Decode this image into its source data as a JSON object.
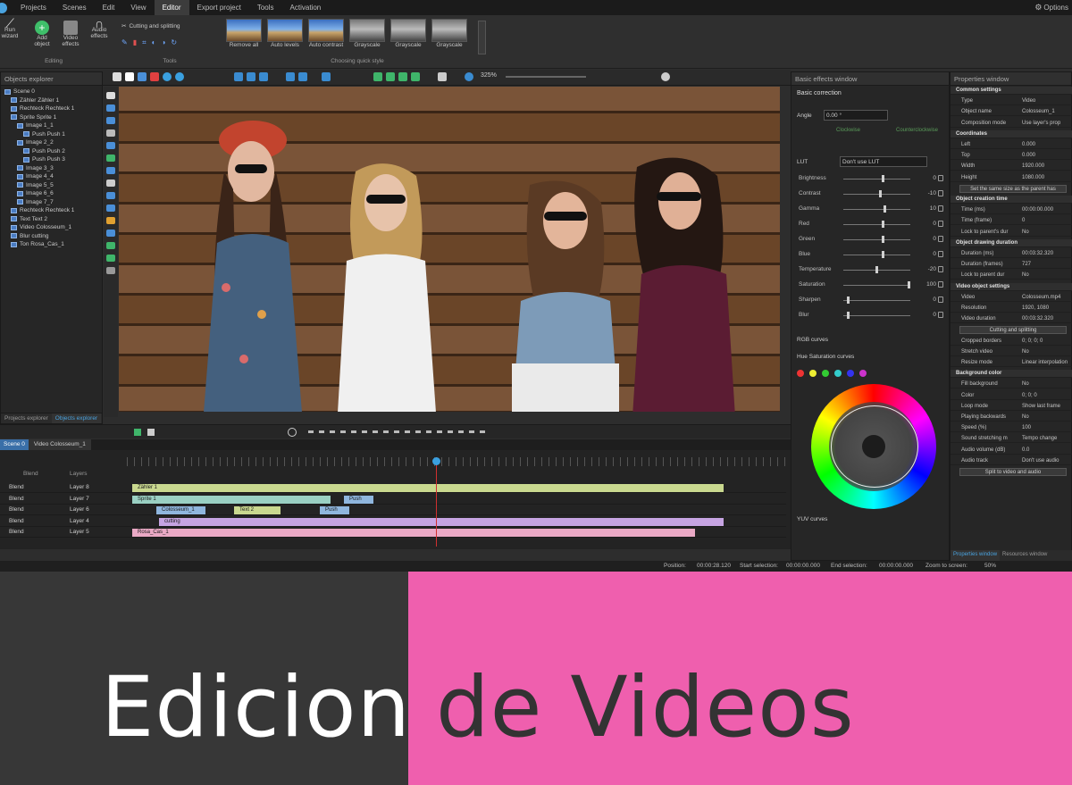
{
  "colors": {
    "accent_pink": "#ef5fae",
    "banner_dark": "#373737",
    "app_bg": "#2d2d2d"
  },
  "menu": [
    "Projects",
    "Scenes",
    "Edit",
    "View",
    "Editor",
    "Export project",
    "Tools",
    "Activation"
  ],
  "menu_active": "Editor",
  "top_right": "Options",
  "ribbon": {
    "run_wizard": "Run wizard",
    "add_object": "Add object",
    "video_effects": "Video effects",
    "audio_effects": "Audio effects",
    "editing_label": "Editing",
    "cutting_splitting": "Cutting and splitting",
    "tools_label": "Tools",
    "quick_styles": [
      "Remove all",
      "Auto levels",
      "Auto contrast",
      "Grayscale",
      "Grayscale",
      "Grayscale"
    ],
    "quick_style_label": "Choosing quick style"
  },
  "zoom": "325%",
  "objects_explorer": {
    "title": "Objects explorer",
    "items": [
      "Scene 0",
      "Zähler Zähler 1",
      "Rechteck Rechteck 1",
      "Sprite Sprite 1",
      "Image 1_1",
      "Push Push 1",
      "Image 2_2",
      "Push Push 2",
      "Push Push 3",
      "Image 3_3",
      "Image 4_4",
      "Image 5_5",
      "Image 6_6",
      "Image 7_7",
      "Rechteck Rechteck 1",
      "Text Text 2",
      "Video Colosseum_1",
      "Blur cutting",
      "Ton Rosa_Cas_1"
    ],
    "tabs": [
      "Projects explorer",
      "Objects explorer"
    ]
  },
  "timeline": {
    "tabs": [
      "Scene 0",
      "Video Colosseum_1"
    ],
    "header": [
      "Blend",
      "Layers"
    ],
    "rows": [
      {
        "blend": "Blend",
        "layer": "Layer 8",
        "clip": "Zähler 1",
        "color": "#c9d88f"
      },
      {
        "blend": "Blend",
        "layer": "Layer 7",
        "clip": "Sprite 1",
        "color": "#9ad0c3"
      },
      {
        "blend": "Blend",
        "layer": "Layer 6",
        "clip": "Colosseum_1",
        "color": "#8fb6de"
      },
      {
        "blend": "Blend",
        "layer": "Layer 4",
        "clip": "cutting",
        "color": "#c6a4e2"
      },
      {
        "blend": "Blend",
        "layer": "Layer 5",
        "clip": "Rosa_Cas_1",
        "color": "#eaa9c5"
      }
    ],
    "extra_clips": [
      "Push",
      "Text 2",
      "Push"
    ]
  },
  "status": {
    "position_label": "Position:",
    "position": "00:00:28.120",
    "start_sel_label": "Start selection:",
    "start_sel": "00:00:00.000",
    "end_sel_label": "End selection:",
    "end_sel": "00:00:00.000",
    "zoom_label": "Zoom to screen:",
    "zoom": "50%"
  },
  "basic_effects": {
    "title": "Basic effects window",
    "section": "Basic correction",
    "angle_label": "Angle",
    "angle": "0.00 °",
    "rotate_left": "Clockwise",
    "rotate_right": "Counterclockwise",
    "lut_label": "LUT",
    "lut": "Don't use LUT",
    "sliders": [
      {
        "name": "Brightness",
        "value": "0",
        "pos": 0.6
      },
      {
        "name": "Contrast",
        "value": "-10",
        "pos": 0.55
      },
      {
        "name": "Gamma",
        "value": "10",
        "pos": 0.62
      },
      {
        "name": "Red",
        "value": "0",
        "pos": 0.6
      },
      {
        "name": "Green",
        "value": "0",
        "pos": 0.6
      },
      {
        "name": "Blue",
        "value": "0",
        "pos": 0.6
      },
      {
        "name": "Temperature",
        "value": "-20",
        "pos": 0.5
      },
      {
        "name": "Saturation",
        "value": "100",
        "pos": 1.0
      },
      {
        "name": "Sharpen",
        "value": "0",
        "pos": 0.05
      },
      {
        "name": "Blur",
        "value": "0",
        "pos": 0.05
      }
    ],
    "rgb_curves": "RGB curves",
    "hue_sat": "Hue Saturation curves",
    "yuv_curves": "YUV curves"
  },
  "properties": {
    "title": "Properties window",
    "sections": [
      {
        "type": "sec",
        "k": "Common settings"
      },
      {
        "type": "row",
        "k": "Type",
        "v": "Video"
      },
      {
        "type": "row",
        "k": "Object name",
        "v": "Colosseum_1"
      },
      {
        "type": "row",
        "k": "Composition mode",
        "v": "Use layer's prop"
      },
      {
        "type": "sec",
        "k": "Coordinates"
      },
      {
        "type": "row",
        "k": "Left",
        "v": "0.000"
      },
      {
        "type": "row",
        "k": "Top",
        "v": "0.000"
      },
      {
        "type": "row",
        "k": "Width",
        "v": "1920.000"
      },
      {
        "type": "row",
        "k": "Height",
        "v": "1080.000"
      },
      {
        "type": "btn",
        "k": "Set the same size as the parent has"
      },
      {
        "type": "sec",
        "k": "Object creation time"
      },
      {
        "type": "row",
        "k": "Time (ms)",
        "v": "00:00:00.000"
      },
      {
        "type": "row",
        "k": "Time (frame)",
        "v": "0"
      },
      {
        "type": "row",
        "k": "Lock to parent's dur",
        "v": "No"
      },
      {
        "type": "sec",
        "k": "Object drawing duration"
      },
      {
        "type": "row",
        "k": "Duration (ms)",
        "v": "00:03:32.320"
      },
      {
        "type": "row",
        "k": "Duration (frames)",
        "v": "727"
      },
      {
        "type": "row",
        "k": "Lock to parent dur",
        "v": "No"
      },
      {
        "type": "sec",
        "k": "Video object settings"
      },
      {
        "type": "row",
        "k": "Video",
        "v": "Colosseum.mp4"
      },
      {
        "type": "row",
        "k": "Resolution",
        "v": "1920, 1080"
      },
      {
        "type": "row",
        "k": "Video duration",
        "v": "00:03:32.320"
      },
      {
        "type": "btn",
        "k": "Cutting and splitting"
      },
      {
        "type": "row",
        "k": "Cropped borders",
        "v": "0; 0; 0; 0"
      },
      {
        "type": "row",
        "k": "Stretch video",
        "v": "No"
      },
      {
        "type": "row",
        "k": "Resize mode",
        "v": "Linear interpolation"
      },
      {
        "type": "sec",
        "k": "Background color"
      },
      {
        "type": "row",
        "k": "Fill background",
        "v": "No"
      },
      {
        "type": "row",
        "k": "Color",
        "v": "0; 0; 0"
      },
      {
        "type": "row",
        "k": "Loop mode",
        "v": "Show last frame"
      },
      {
        "type": "row",
        "k": "Playing backwards",
        "v": "No"
      },
      {
        "type": "row",
        "k": "Speed (%)",
        "v": "100"
      },
      {
        "type": "row",
        "k": "Sound stretching m",
        "v": "Tempo change"
      },
      {
        "type": "row",
        "k": "Audio volume (dB)",
        "v": "0.0"
      },
      {
        "type": "row",
        "k": "Audio track",
        "v": "Don't use audio"
      },
      {
        "type": "btn",
        "k": "Split to video and audio"
      }
    ],
    "tabs": [
      "Properties window",
      "Resources window"
    ]
  },
  "banner": {
    "word1": "Edicion",
    "word2": "de Videos"
  }
}
